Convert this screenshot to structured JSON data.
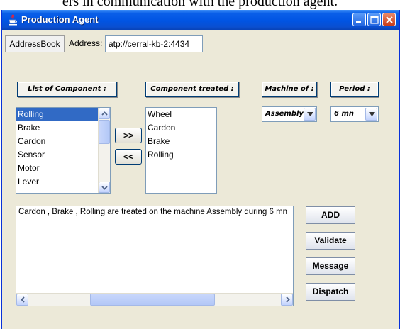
{
  "caption_fragment": "ers in communication with the production agent.",
  "window": {
    "title": "Production Agent",
    "controls": {
      "minimize": "minimize",
      "maximize": "maximize",
      "close": "close"
    }
  },
  "address": {
    "addressbook_label": "AddressBook",
    "label": "Address:",
    "value": "atp://cerral-kb-2:4434"
  },
  "headers": {
    "list_of_component": "List of Component :",
    "component_treated": "Component treated :",
    "machine_of": "Machine of :",
    "period": "Period :"
  },
  "components_list": {
    "items": [
      "Rolling",
      "Brake",
      "Cardon",
      "Sensor",
      "Motor",
      "Lever"
    ],
    "selected": "Rolling"
  },
  "move_buttons": {
    "add_right": ">>",
    "remove_left": "<<"
  },
  "treated_list": {
    "items": [
      "Wheel",
      "Cardon",
      "Brake",
      "Rolling"
    ]
  },
  "machine_select": {
    "value": "Assembly"
  },
  "period_select": {
    "value": "6 mn"
  },
  "output": {
    "text": "Cardon , Brake , Rolling are treated on the machine  Assembly  during  6 mn"
  },
  "actions": {
    "add": "ADD",
    "validate": "Validate",
    "message": "Message",
    "dispatch": "Dispatch"
  },
  "colors": {
    "titlebar": "#0054e3",
    "selection": "#316ac5",
    "window_bg": "#ece9d8"
  }
}
